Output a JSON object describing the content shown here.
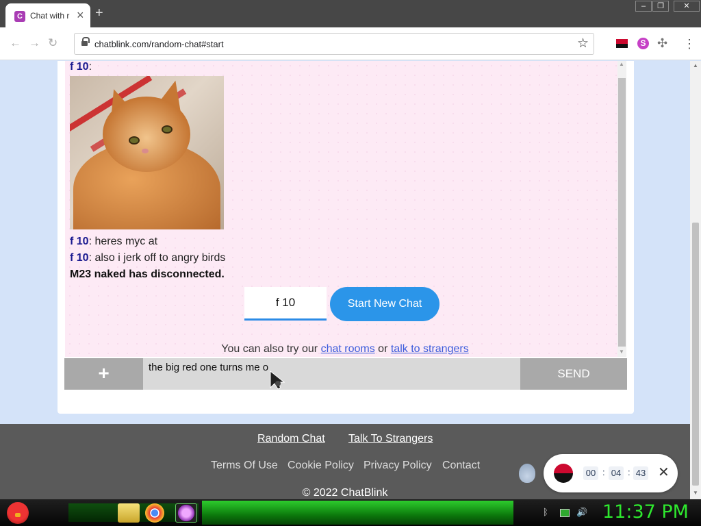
{
  "browser": {
    "tab_title": "Chat with r",
    "tab_favicon_letter": "C",
    "url": "chatblink.com/random-chat#start",
    "window_controls": [
      "minimize",
      "restore",
      "close"
    ]
  },
  "chat": {
    "messages": [
      {
        "who": "f 10",
        "text": ":"
      },
      {
        "who": "f 10",
        "text": ": heres myc at"
      },
      {
        "who": "f 10",
        "text": ": also i jerk off to angry birds"
      }
    ],
    "system_message": "M23 naked has disconnected.",
    "stranger_label": "f 10",
    "start_new_chat": "Start New Chat",
    "also_prefix": "You can also try our",
    "chat_rooms_link": "chat rooms",
    "or_text": "or",
    "talk_to_strangers_link": "talk to strangers"
  },
  "composer": {
    "plus_label": "+",
    "input_value": "the big red one turns me o",
    "send_label": "SEND"
  },
  "footer": {
    "random_chat": "Random Chat",
    "talk_to_strangers": "Talk To Strangers",
    "terms": "Terms Of Use",
    "cookie": "Cookie Policy",
    "privacy": "Privacy Policy",
    "contact": "Contact",
    "copyright": "© 2022 ChatBlink"
  },
  "timer": {
    "hours": "00",
    "minutes": "04",
    "seconds": "43",
    "separator": ":"
  },
  "taskbar": {
    "clock": "11:37 PM"
  },
  "colors": {
    "accent_blue": "#2b95e9",
    "chat_bg": "#fdeaf5",
    "clock_green": "#2ee82e"
  }
}
